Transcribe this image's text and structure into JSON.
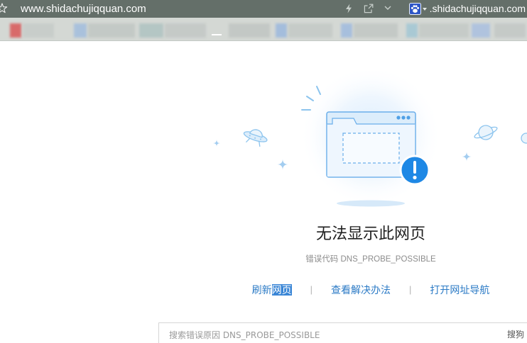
{
  "browser": {
    "address": "www.shidachujiqquan.com",
    "search_engine_text": ".shidachujiqquan.com"
  },
  "icons": {
    "favorite": "star-icon",
    "speed": "lightning-icon",
    "share": "share-icon",
    "menu": "chevron-down-icon",
    "search_engine": "baidu-paw-icon",
    "search_engine_dropdown": "caret-down-icon",
    "illustration": [
      "browser-window-icon",
      "exclamation-circle-icon",
      "ufo-icon",
      "planet-icon",
      "sparkle-icon"
    ]
  },
  "error_page": {
    "title": "无法显示此网页",
    "error_code": "错误代码 DNS_PROBE_POSSIBLE",
    "actions": {
      "refresh_prefix": "刷新",
      "refresh_selected": "网页",
      "solutions": "查看解决办法",
      "navigation": "打开网址导航",
      "separator": "|"
    },
    "search": {
      "placeholder": "搜索错误原因 DNS_PROBE_POSSIBLE",
      "button_label": "搜狗"
    }
  },
  "colors": {
    "accent": "#1e88e5",
    "link": "#2c7bc6",
    "selection": "#3a86d6",
    "title": "#1f1f1f",
    "muted": "#8c8c8c"
  }
}
